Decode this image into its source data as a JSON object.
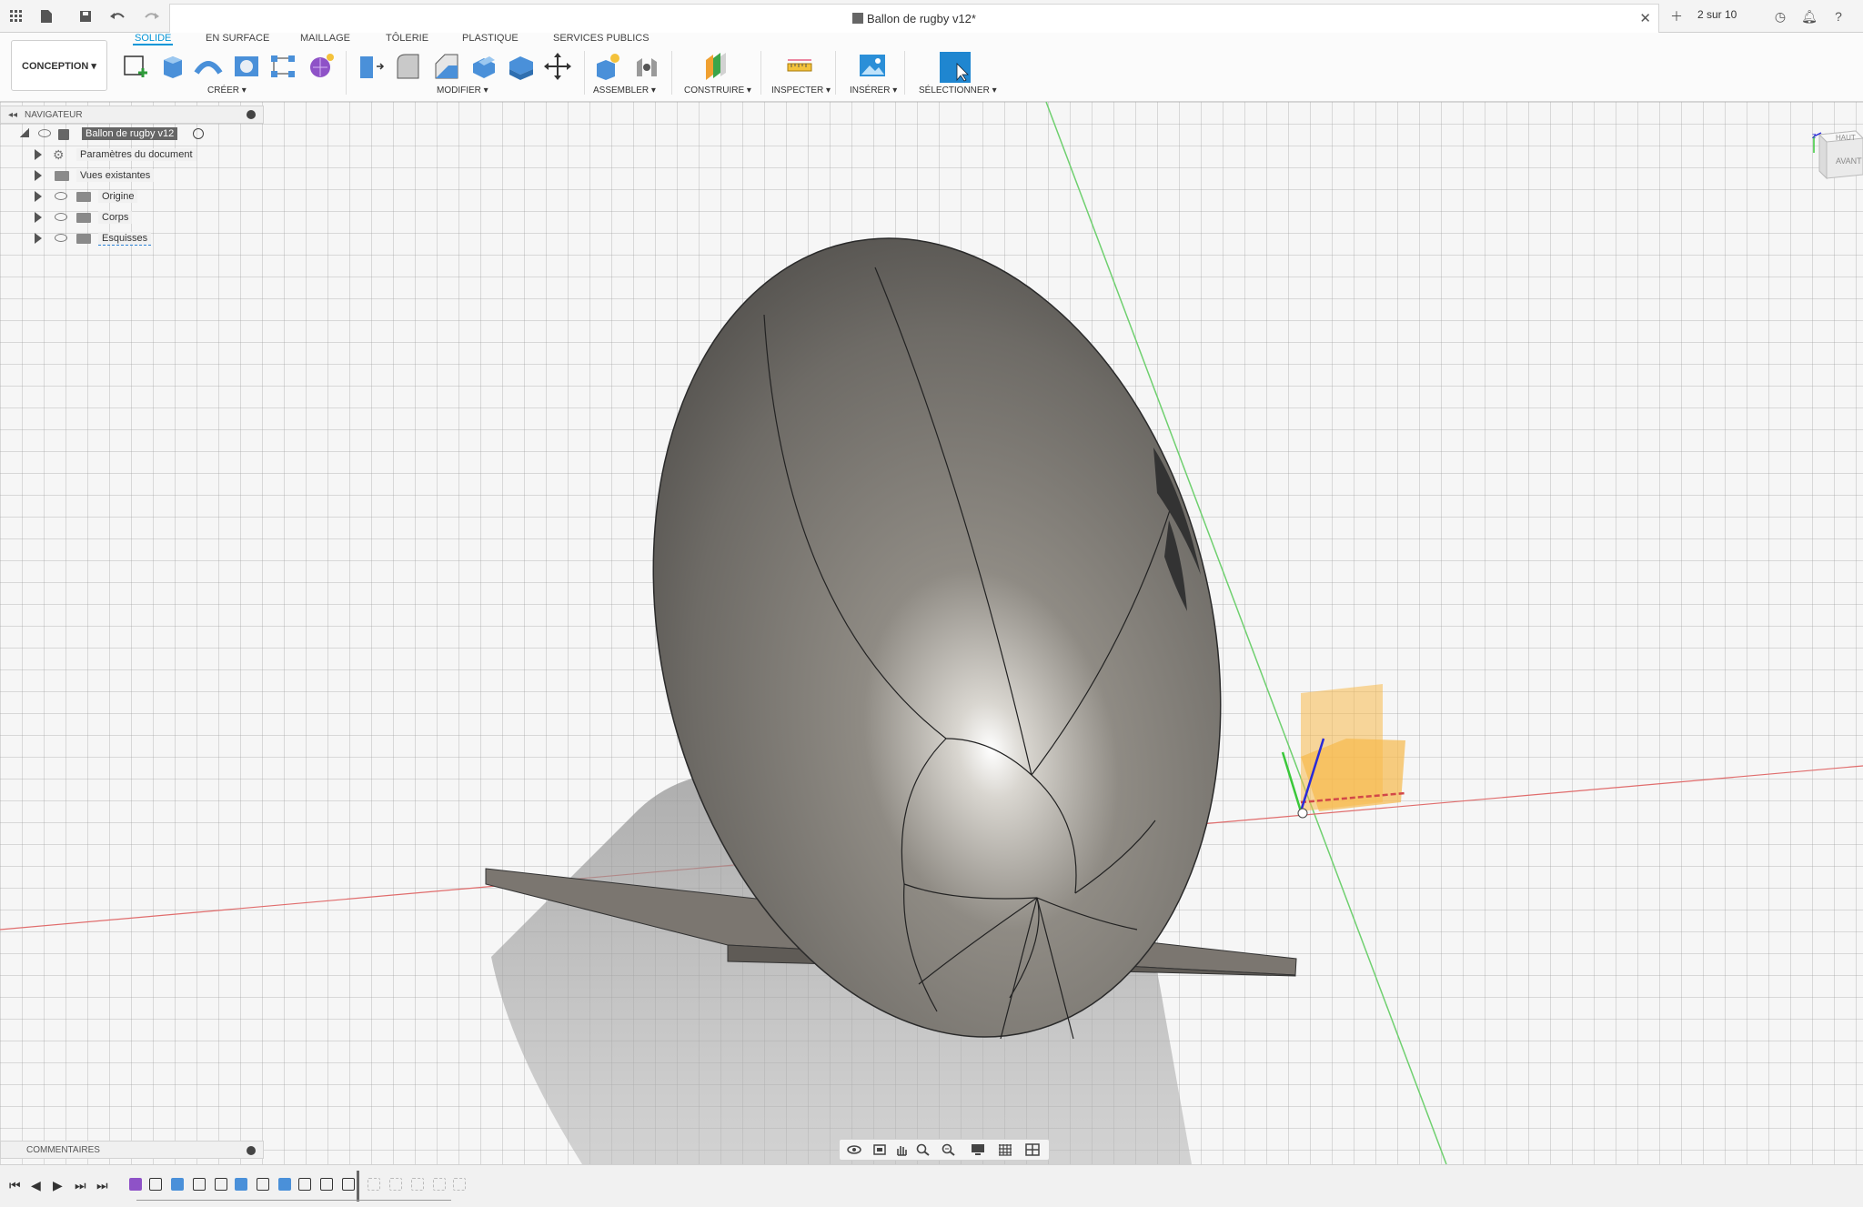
{
  "titlebar": {
    "doc_title": "Ballon de rugby v12*",
    "pager": "2 sur 10"
  },
  "toolbar": {
    "workspace": "CONCEPTION ▾",
    "tabs": [
      "SOLIDE",
      "EN SURFACE",
      "MAILLAGE",
      "TÔLERIE",
      "PLASTIQUE",
      "SERVICES PUBLICS"
    ],
    "groups": [
      "CRÉER ▾",
      "MODIFIER ▾",
      "ASSEMBLER ▾",
      "CONSTRUIRE ▾",
      "INSPECTER ▾",
      "INSÉRER ▾",
      "SÉLECTIONNER ▾"
    ]
  },
  "navigator": {
    "title": "NAVIGATEUR",
    "root": "Ballon de rugby v12",
    "items": [
      "Paramètres du document",
      "Vues existantes",
      "Origine",
      "Corps",
      "Esquisses"
    ]
  },
  "comments": {
    "title": "COMMENTAIRES"
  },
  "viewcube": {
    "top": "HAUT",
    "front": "AVANT"
  },
  "colors": {
    "accent": "#0696d7",
    "ball": "#8a8781",
    "plate": "#7b7670",
    "plane": "#f7b94c"
  },
  "icons": {
    "menu": "grid-icon",
    "file": "file-icon",
    "save": "save-icon",
    "undo": "undo-icon",
    "redo": "redo-icon"
  }
}
